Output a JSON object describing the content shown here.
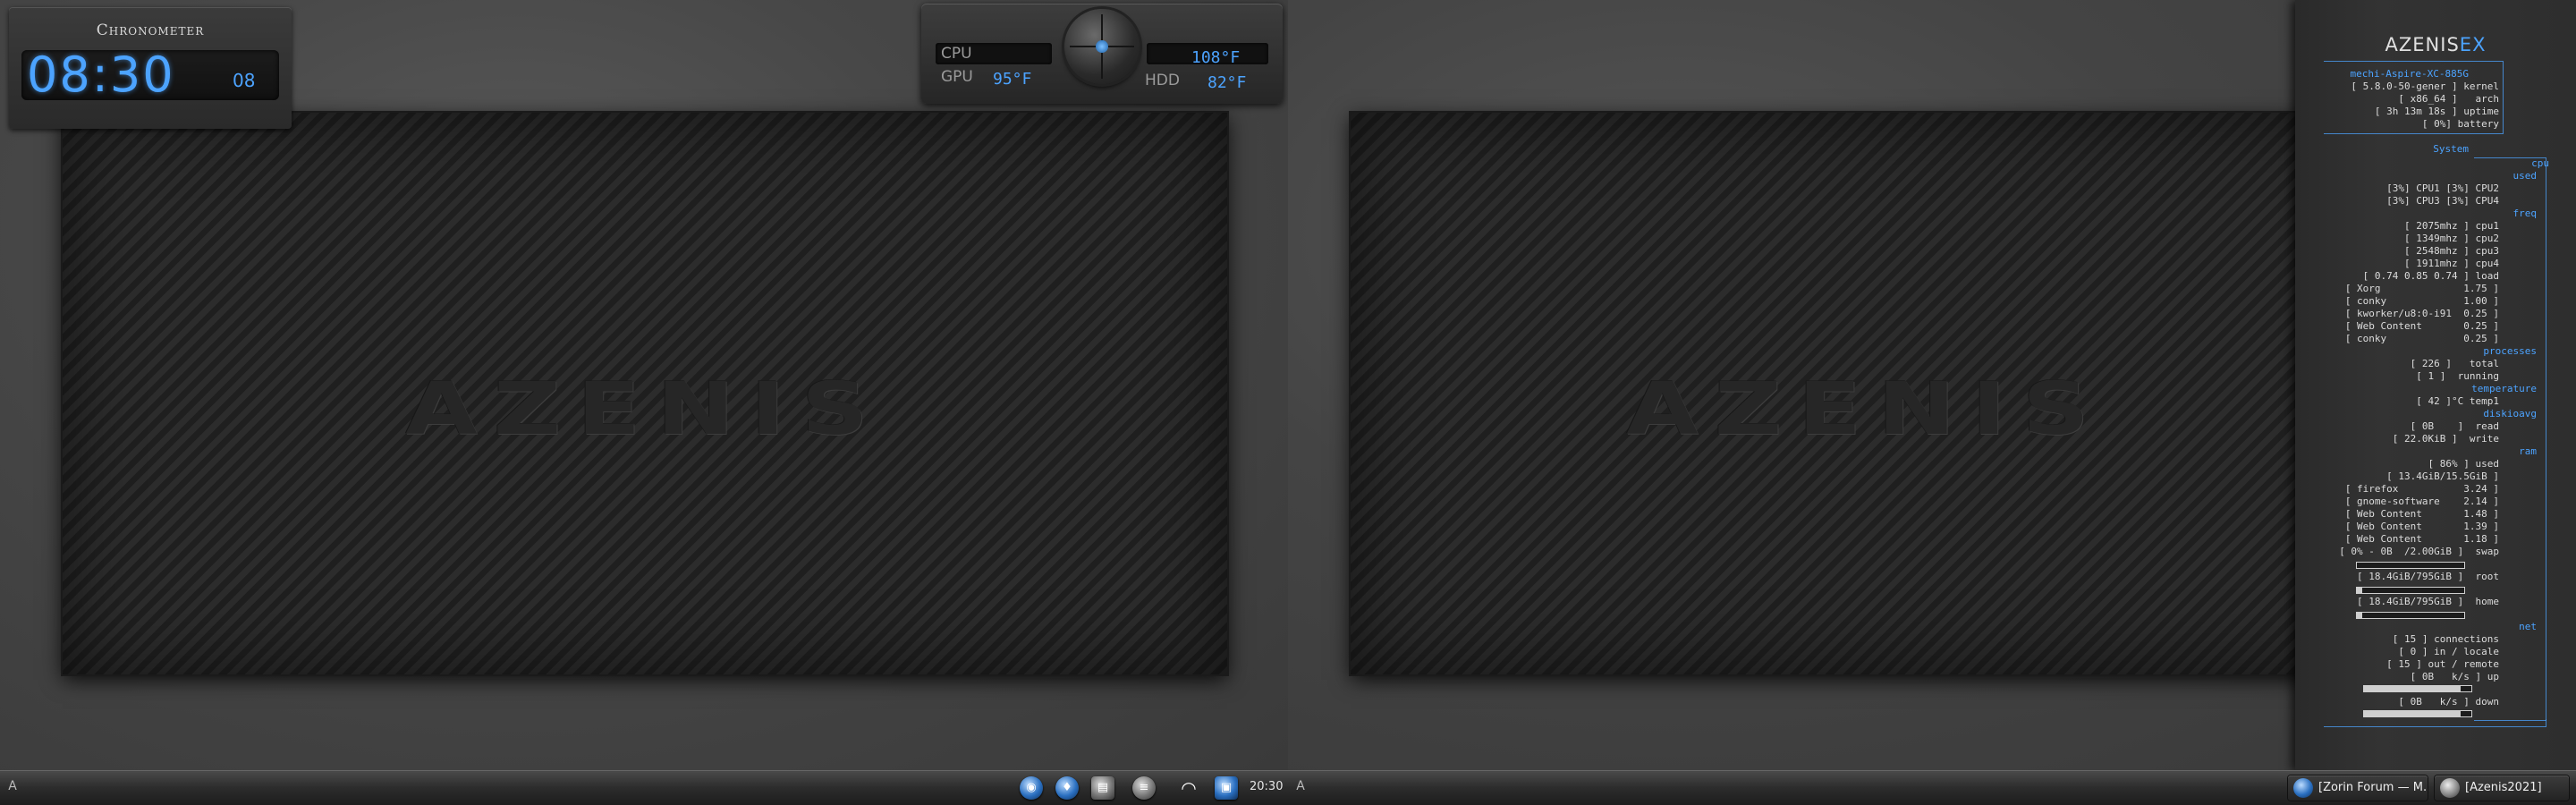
{
  "chronometer": {
    "title": "Chronometer",
    "time": "08:30",
    "seconds": "08"
  },
  "temps": {
    "cpu_label": "CPU",
    "gpu_label": "GPU",
    "hdd_label": "HDD",
    "cpu_value": "108°F",
    "gpu_value": "95°F",
    "hdd_value": "82°F"
  },
  "wallpaper_text": "AZENIS",
  "conky": {
    "title_a": "AZENIS",
    "title_b": "EX",
    "host": "mechi-Aspire-XC-885G",
    "kernel": "[ 5.8.0-50-gener ] kernel",
    "arch": "[ x86_64 ]   arch",
    "uptime": "[ 3h 13m 18s ] uptime",
    "battery": "[ 0%] battery",
    "system_label": "System",
    "cpu_label": "cpu",
    "used_label": "used",
    "cpu_row1": "[3%] CPU1 [3%] CPU2",
    "cpu_row2": "[3%] CPU3 [3%] CPU4",
    "freq_label": "freq",
    "freq1": "[ 2075mhz ] cpu1",
    "freq2": "[ 1349mhz ] cpu2",
    "freq3": "[ 2548mhz ] cpu3",
    "freq4": "[ 1911mhz ] cpu4",
    "load": "[ 0.74 0.85 0.74 ] load",
    "proc1": "[ Xorg              1.75 ]",
    "proc2": "[ conky             1.00 ]",
    "proc3": "[ kworker/u8:0-i91  0.25 ]",
    "proc4": "[ Web Content       0.25 ]",
    "proc5": "[ conky             0.25 ]",
    "processes_label": "processes",
    "proc_total": "[ 226 ]   total",
    "proc_running": "[ 1 ]  running",
    "temperature_label": "temperature",
    "temp1": "[ 42 ]°C temp1",
    "diskio_label": "diskioavg",
    "disk_read": "[ 0B    ]  read",
    "disk_write": "[ 22.0KiB ]  write",
    "ram_label": "ram",
    "ram_used": "[ 86% ] used",
    "ram_total": "[ 13.4GiB/15.5GiB ]",
    "mem1": "[ firefox           3.24 ]",
    "mem2": "[ gnome-software    2.14 ]",
    "mem3": "[ Web Content       1.48 ]",
    "mem4": "[ Web Content       1.39 ]",
    "mem5": "[ Web Content       1.18 ]",
    "swap": "[ 0% - 0B  /2.00GiB ]  swap",
    "swap_level": 0.0,
    "root": "[ 18.4GiB/795GiB ]  root",
    "root_level": 0.05,
    "home": "[ 18.4GiB/795GiB ]  home",
    "home_level": 0.05,
    "net_label": "net",
    "connections": "[ 15 ] connections",
    "in_locale": "[ 0 ] in / locale",
    "out_remote": "[ 15 ] out / remote",
    "up": "[ 0B   k/s ] up",
    "down": "[ 0B   k/s ] down",
    "up_level": 0.9,
    "down_level": 0.9
  },
  "taskbar": {
    "menu_icon": "A",
    "clock": "20:30",
    "tasks": [
      "[Zorin Forum — M...",
      "[Azenis2021]"
    ]
  },
  "colors": {
    "accent": "#4ca3ff"
  }
}
